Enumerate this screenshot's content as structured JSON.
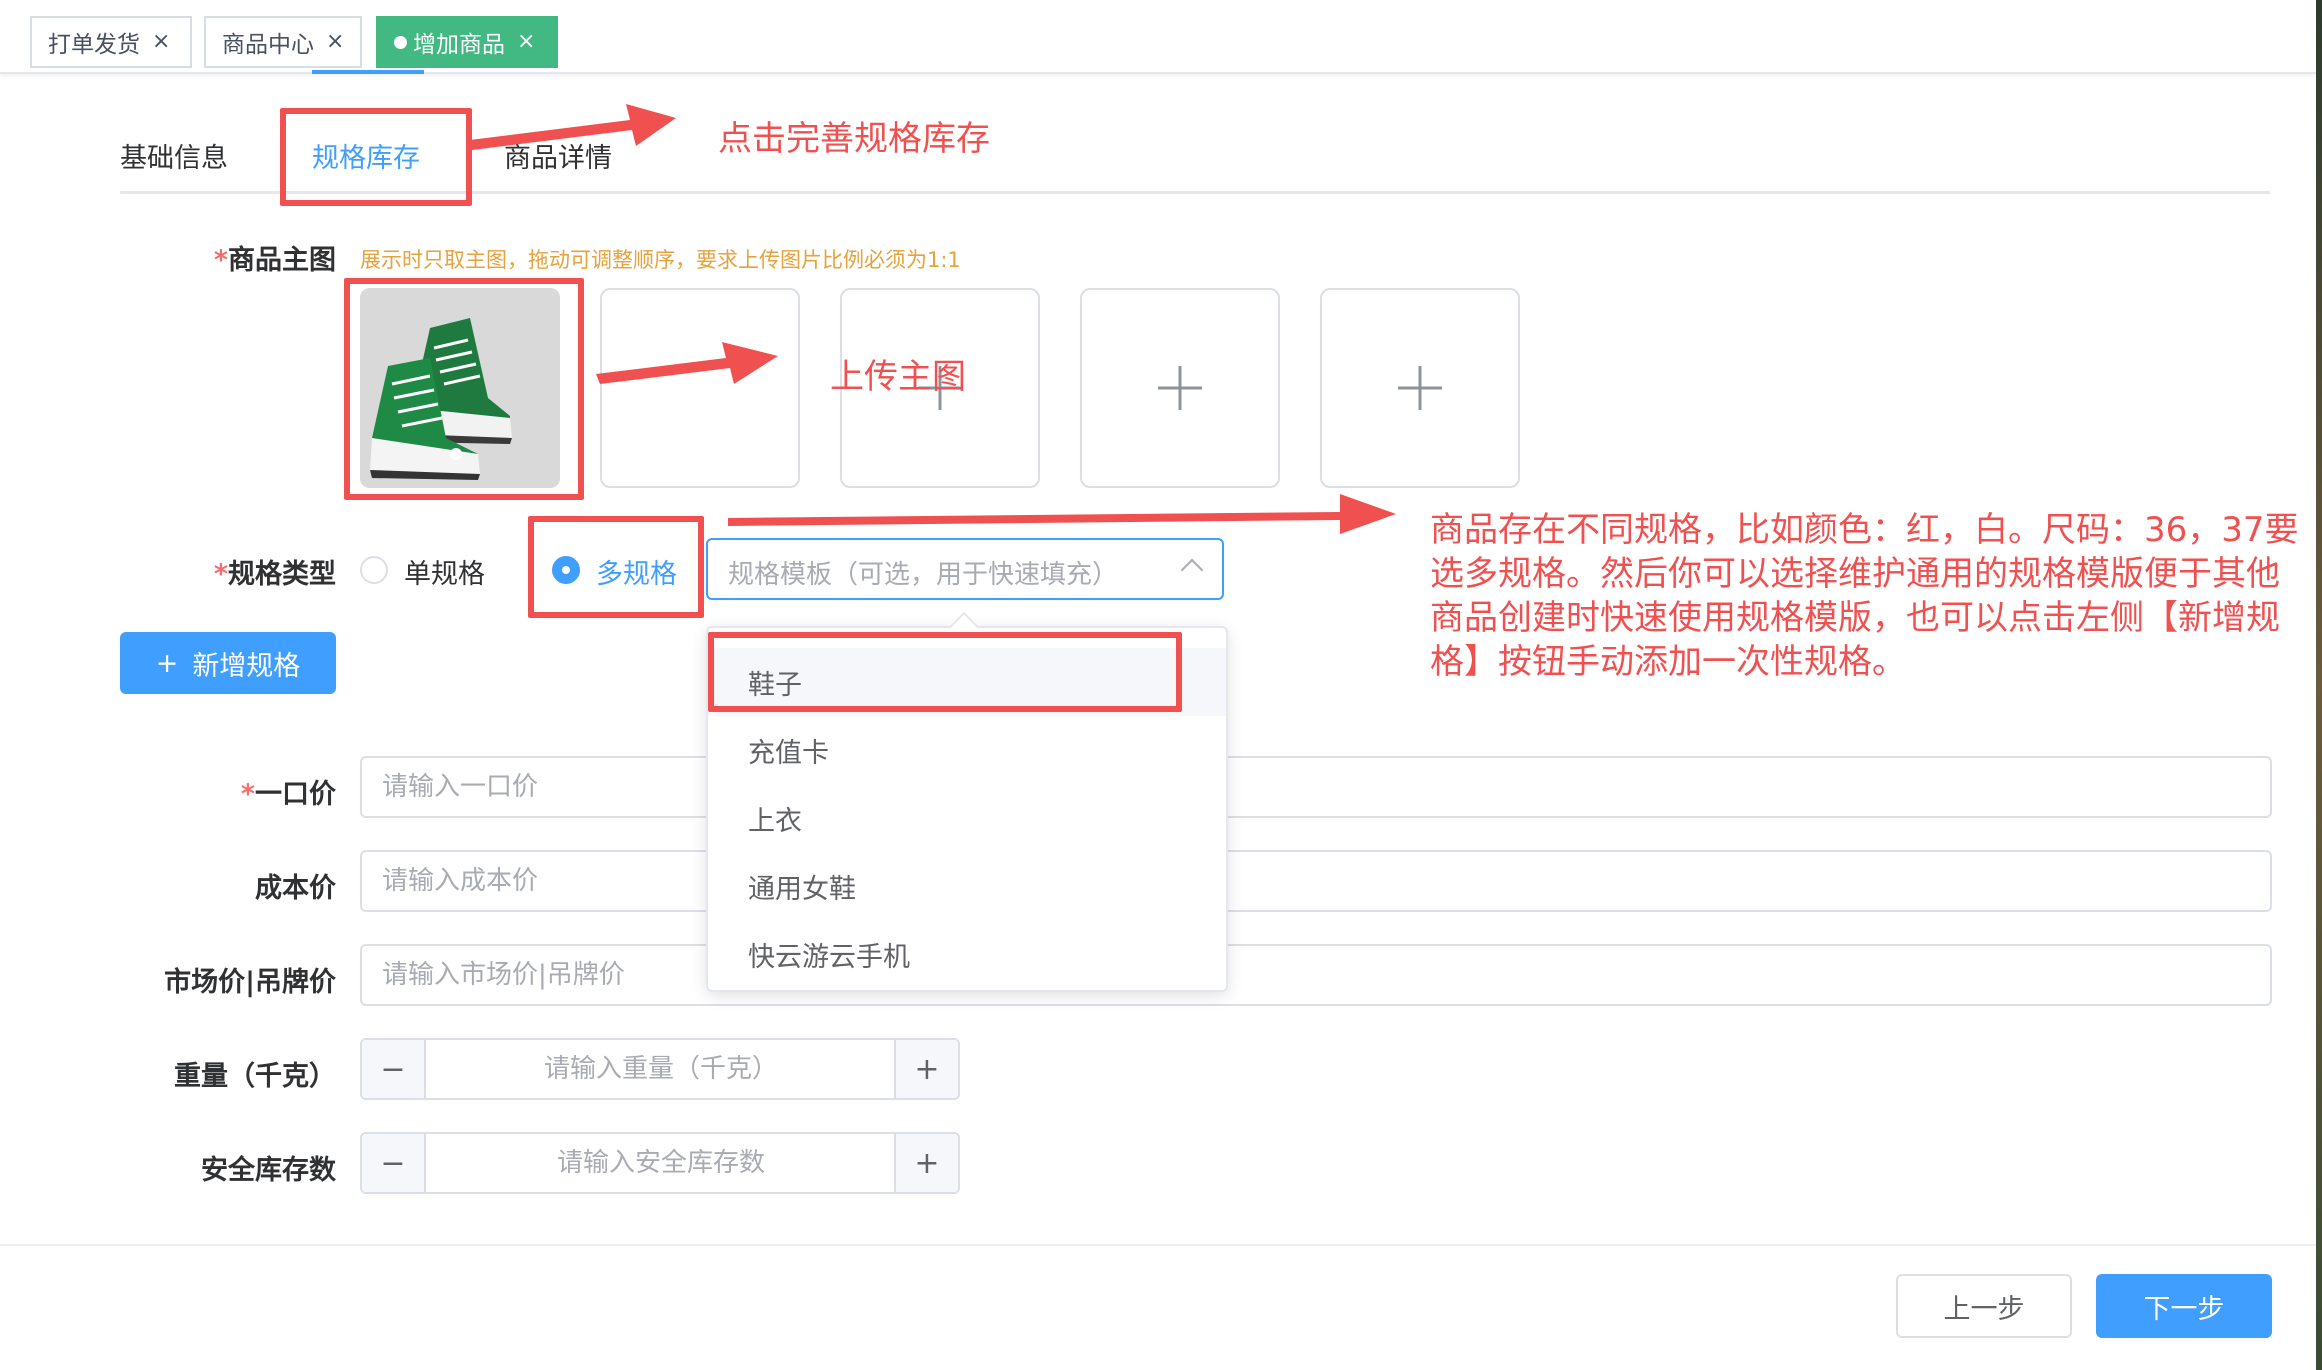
{
  "tags": [
    {
      "label": "打单发货",
      "close": "×"
    },
    {
      "label": "商品中心",
      "close": "×"
    },
    {
      "label": "增加商品",
      "close": "×"
    }
  ],
  "tabs": {
    "basic": "基础信息",
    "spec": "规格库存",
    "detail": "商品详情"
  },
  "annotations": {
    "tab_hint": "点击完善规格库存",
    "upload_hint": "上传主图",
    "spec_hint": "商品存在不同规格，比如颜色：红，白。尺码：36，37要选多规格。然后你可以选择维护通用的规格模版便于其他商品创建时快速使用规格模版，也可以点击左侧【新增规格】按钮手动添加一次性规格。"
  },
  "main_image": {
    "label": "商品主图",
    "required_mark": "*",
    "hint": "展示时只取主图，拖动可调整顺序，要求上传图片比例必须为1:1",
    "add_icon": "plus-icon"
  },
  "spec_type": {
    "label": "规格类型",
    "required_mark": "*",
    "single": "单规格",
    "multi": "多规格",
    "selected": "多规格"
  },
  "template_select": {
    "placeholder": "规格模板（可选，用于快速填充）",
    "options": [
      "鞋子",
      "充值卡",
      "上衣",
      "通用女鞋",
      "快云游云手机"
    ],
    "hovered": "鞋子"
  },
  "add_spec_button": {
    "icon": "+",
    "label": "新增规格"
  },
  "fields": {
    "price": {
      "label": "一口价",
      "required_mark": "*",
      "placeholder": "请输入一口价"
    },
    "cost": {
      "label": "成本价",
      "placeholder": "请输入成本价"
    },
    "market": {
      "label": "市场价|吊牌价",
      "placeholder": "请输入市场价|吊牌价"
    },
    "weight": {
      "label": "重量（千克）",
      "placeholder": "请输入重量（千克）",
      "minus": "−",
      "plus": "+"
    },
    "safety": {
      "label": "安全库存数",
      "placeholder": "请输入安全库存数",
      "minus": "−",
      "plus": "+"
    }
  },
  "footer": {
    "prev": "上一步",
    "next": "下一步"
  },
  "colors": {
    "primary": "#409eff",
    "active_tag": "#42b983",
    "annotation": "#f05050",
    "hint": "#e6a23c"
  }
}
